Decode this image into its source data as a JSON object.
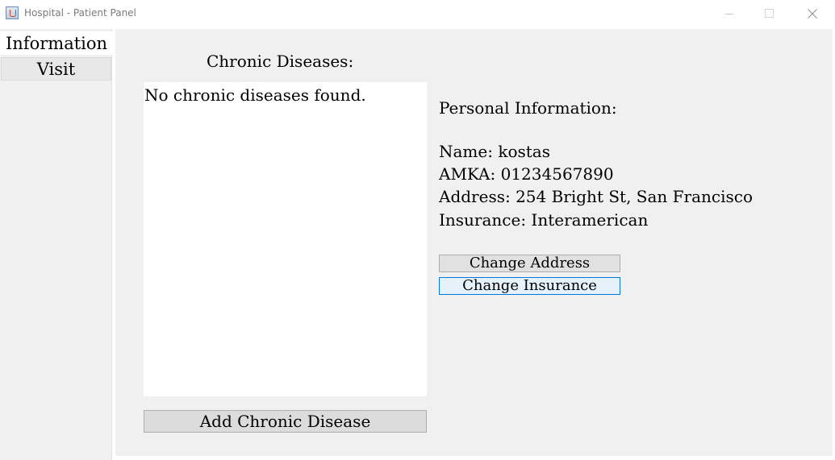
{
  "window": {
    "title": "Hospital - Patient Panel"
  },
  "sidebar": {
    "tabs": [
      {
        "label": "Information"
      },
      {
        "label": "Visit"
      }
    ]
  },
  "chronic": {
    "title": "Chronic Diseases:",
    "items": [
      "No chronic diseases found."
    ],
    "add_button": "Add Chronic Disease"
  },
  "personal": {
    "title": "Personal Information:",
    "name": "Name: kostas",
    "amka": "AMKA: 01234567890",
    "address": "Address: 254 Bright St, San Francisco",
    "insurance": "Insurance: Interamerican",
    "change_address_button": "Change Address",
    "change_insurance_button": "Change Insurance"
  },
  "icons": {
    "app": "java-app-icon",
    "minimize": "minimize-icon",
    "maximize": "maximize-icon",
    "close": "close-icon"
  },
  "colors": {
    "panel_background": "#f0f0f0",
    "focused_button_border": "#0078d7",
    "focused_button_fill": "#e5f1fb"
  }
}
